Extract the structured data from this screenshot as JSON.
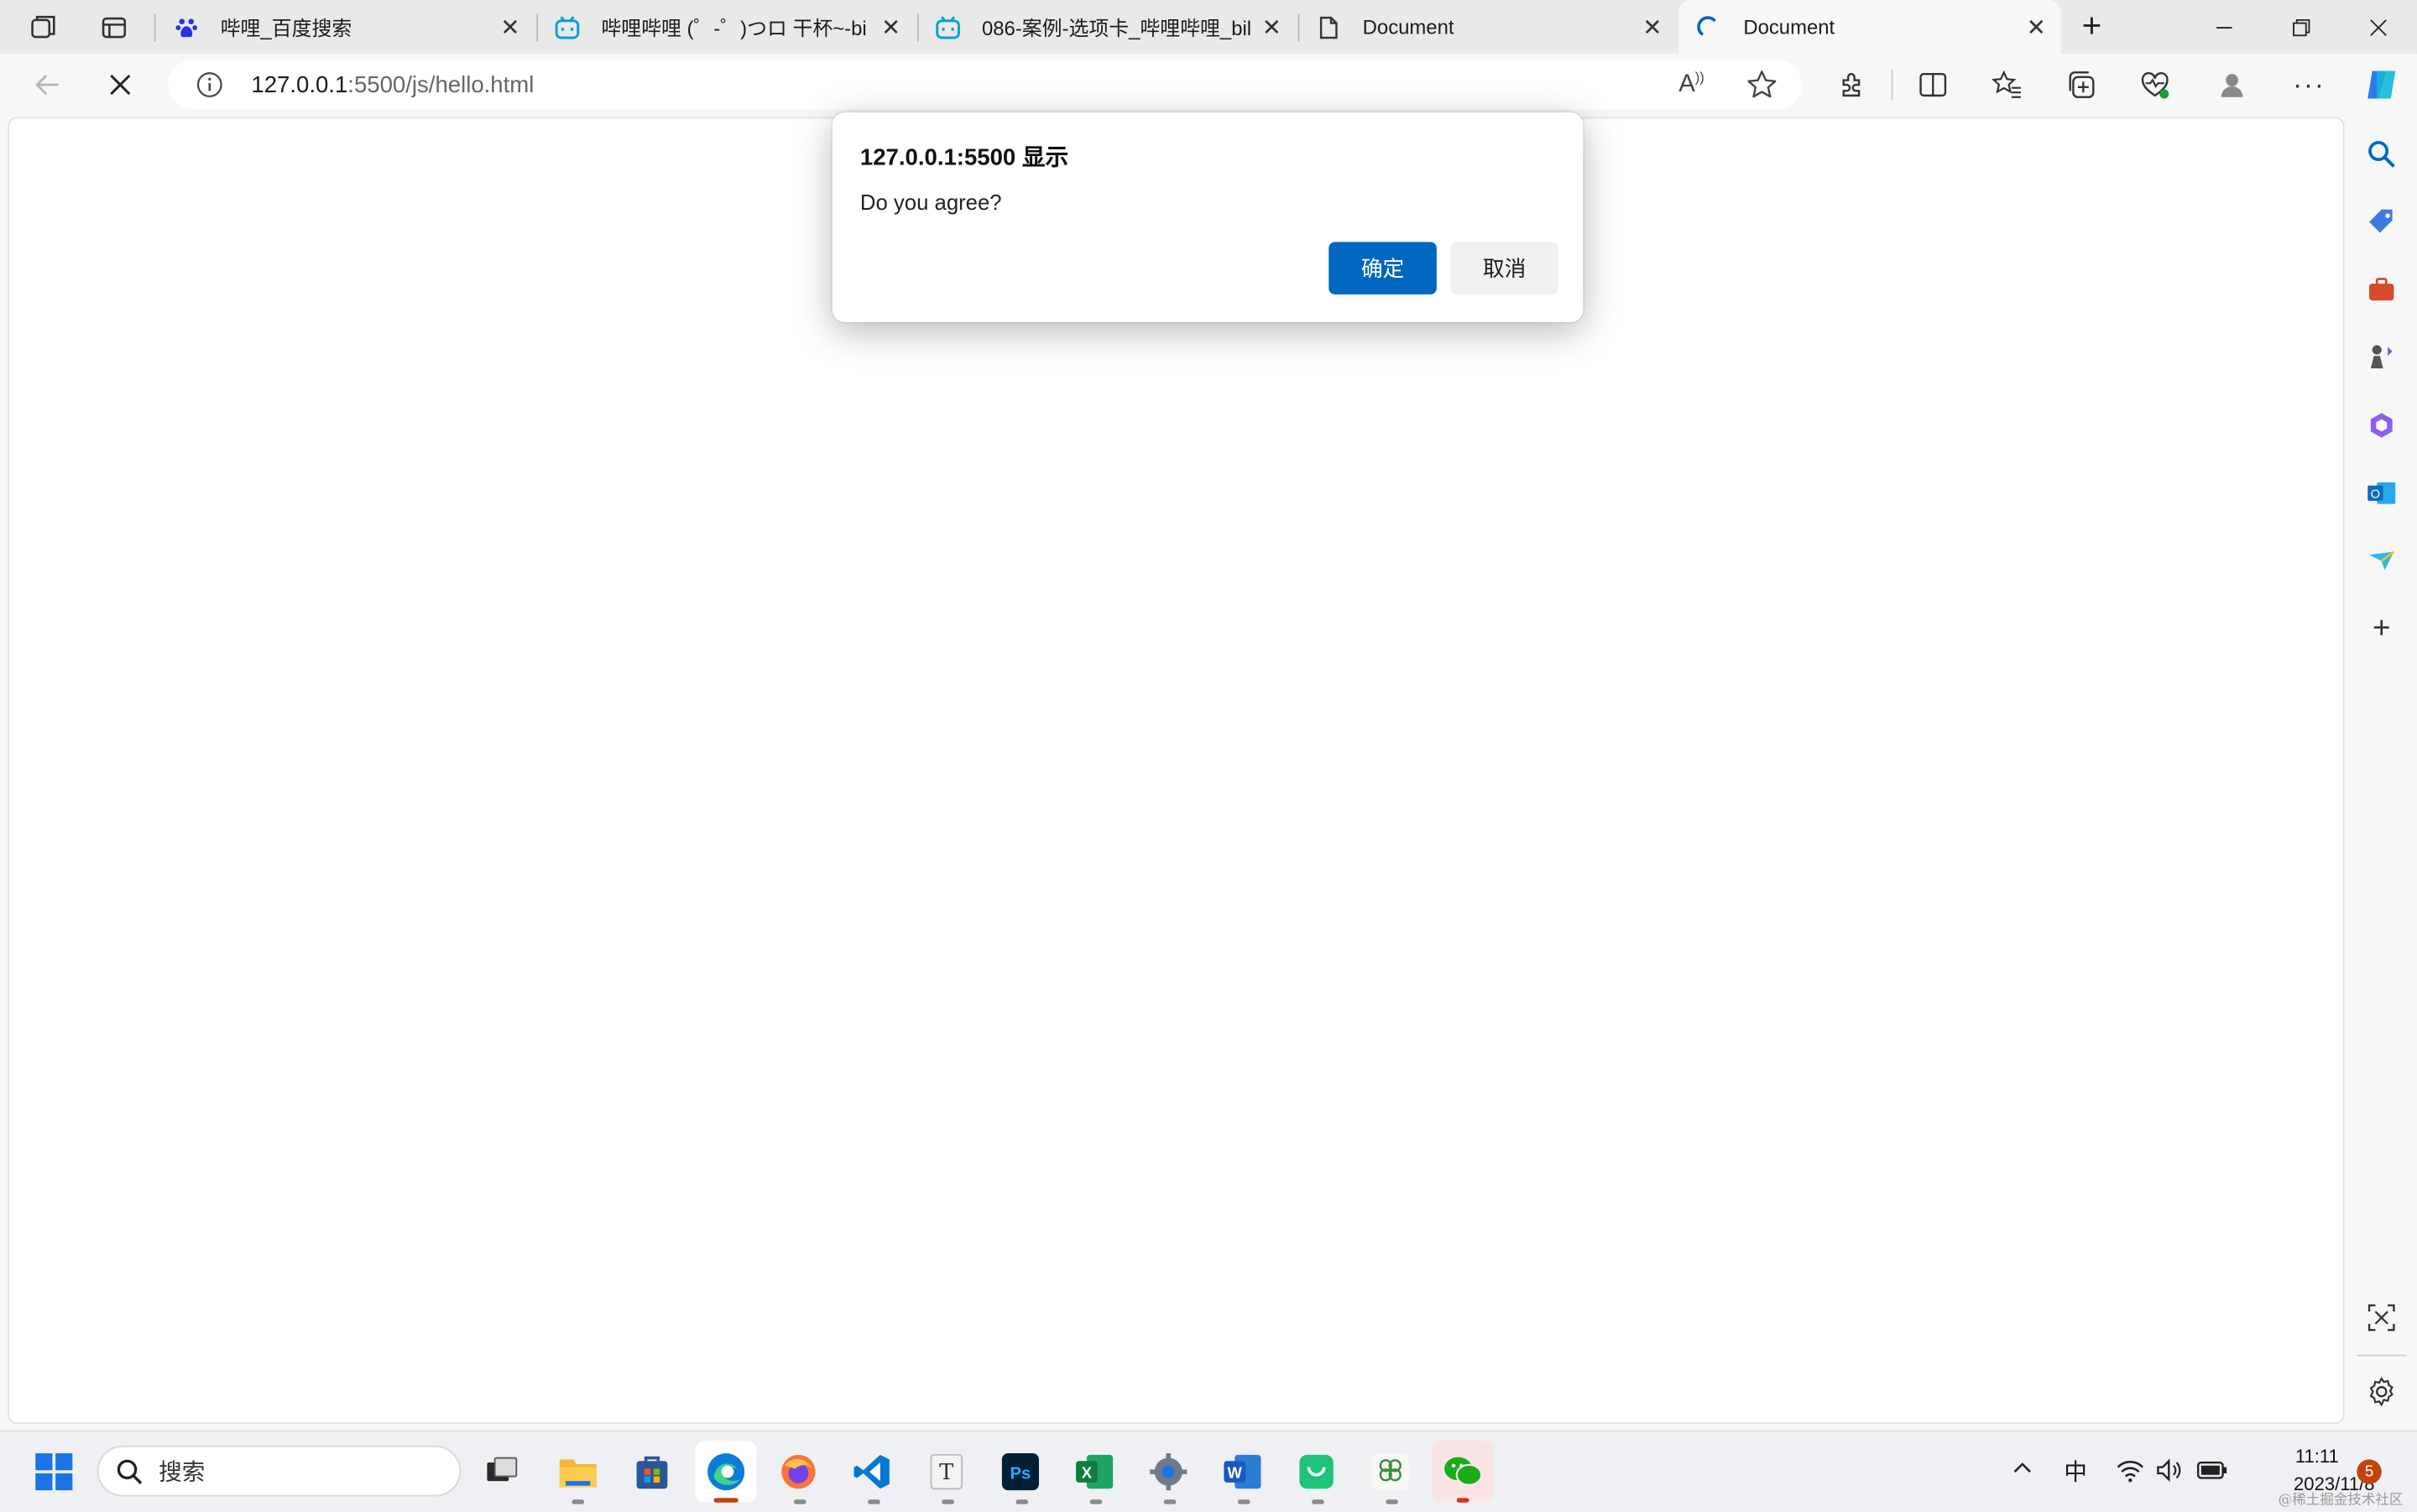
{
  "tabs": [
    {
      "title": "哔哩_百度搜索",
      "icon": "baidu-paw-icon"
    },
    {
      "title": "哔哩哔哩 (゜-゜)つロ 干杯~-bi",
      "icon": "bilibili-icon"
    },
    {
      "title": "086-案例-选项卡_哔哩哔哩_bil",
      "icon": "bilibili-icon"
    },
    {
      "title": "Document",
      "icon": "document-icon"
    },
    {
      "title": "Document",
      "icon": "loading-spinner-icon",
      "active": true
    }
  ],
  "address": {
    "host": "127.0.0.1",
    "path": ":5500/js/hello.html"
  },
  "dialog": {
    "title": "127.0.0.1:5500 显示",
    "message": "Do you agree?",
    "ok_label": "确定",
    "cancel_label": "取消"
  },
  "taskbar": {
    "search_label": "搜索",
    "ime": "中",
    "time": "11:11",
    "date": "2023/11/8",
    "notification_count": "5",
    "watermark": "@稀土掘金技术社区"
  },
  "colors": {
    "accent": "#0067c0",
    "tabstrip": "#e9e9e9",
    "bilibili": "#00a1d6",
    "baidu": "#2932e1"
  }
}
